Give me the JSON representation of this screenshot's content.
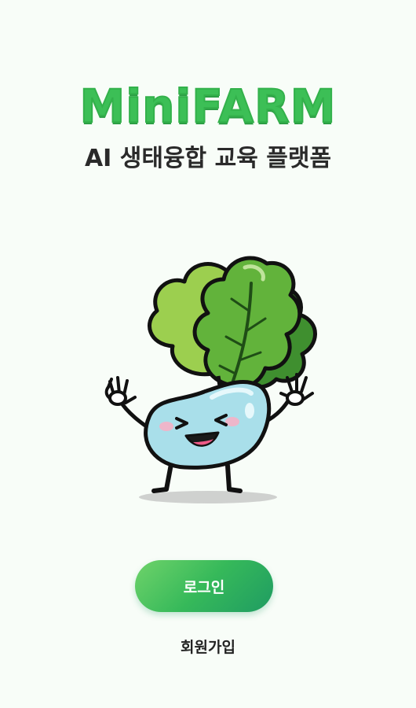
{
  "app": {
    "logo_text": "MiniFARM",
    "subtitle": "AI 생태융합 교육 플랫폼"
  },
  "mascot": {
    "icon": "radish-mascot-icon"
  },
  "actions": {
    "login_label": "로그인",
    "signup_label": "회원가입"
  },
  "colors": {
    "background": "#f8fdf8",
    "brand_green": "#3cbf56",
    "button_gradient_start": "#6fd36a",
    "button_gradient_end": "#1f9c62",
    "text_dark": "#2a2a2a"
  }
}
